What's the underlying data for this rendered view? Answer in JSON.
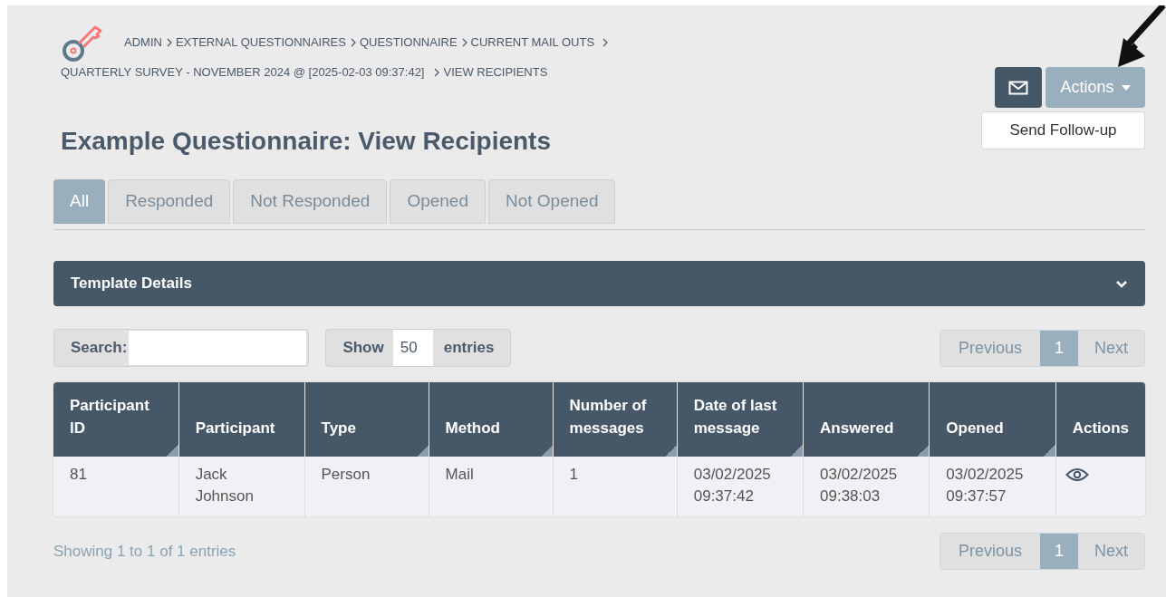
{
  "breadcrumb": [
    {
      "label": "ADMIN"
    },
    {
      "label": "EXTERNAL QUESTIONNAIRES"
    },
    {
      "label": "QUESTIONNAIRE"
    },
    {
      "label": "CURRENT MAIL OUTS"
    },
    {
      "label": "QUARTERLY SURVEY - NOVEMBER 2024 @ [2025-02-03 09:37:42]"
    },
    {
      "label": "VIEW RECIPIENTS"
    }
  ],
  "actions": {
    "label": "Actions",
    "menu": [
      "Send Follow-up"
    ]
  },
  "title": "Example Questionnaire: View Recipients",
  "tabs": [
    {
      "label": "All",
      "selected": true
    },
    {
      "label": "Responded",
      "selected": false
    },
    {
      "label": "Not Responded",
      "selected": false
    },
    {
      "label": "Opened",
      "selected": false
    },
    {
      "label": "Not Opened",
      "selected": false
    }
  ],
  "panel": {
    "title": "Template Details",
    "expanded": false
  },
  "search": {
    "label": "Search:"
  },
  "length": {
    "before": "Show",
    "value": "50",
    "after": "entries"
  },
  "pagination_top": {
    "previous": "Previous",
    "pages": [
      {
        "label": "1",
        "selected": true
      }
    ],
    "next": "Next"
  },
  "table": {
    "columns": [
      {
        "label": "Participant ID",
        "sortable": true
      },
      {
        "label": "Participant",
        "sortable": false
      },
      {
        "label": "Type",
        "sortable": true
      },
      {
        "label": "Method",
        "sortable": true
      },
      {
        "label": "Number of messages",
        "sortable": true
      },
      {
        "label": "Date of last message",
        "sortable": true
      },
      {
        "label": "Answered",
        "sortable": true
      },
      {
        "label": "Opened",
        "sortable": true
      },
      {
        "label": "Actions",
        "sortable": false
      }
    ],
    "rows": [
      {
        "cells": [
          "81",
          "Jack Johnson",
          "Person",
          "Mail",
          "1",
          "03/02/2025 09:37:42",
          "03/02/2025 09:38:03",
          "03/02/2025 09:37:57"
        ]
      }
    ]
  },
  "info": "Showing 1 to 1 of 1 entries",
  "pagination_bottom": {
    "previous": "Previous",
    "pages": [
      {
        "label": "1",
        "selected": true
      }
    ],
    "next": "Next"
  }
}
